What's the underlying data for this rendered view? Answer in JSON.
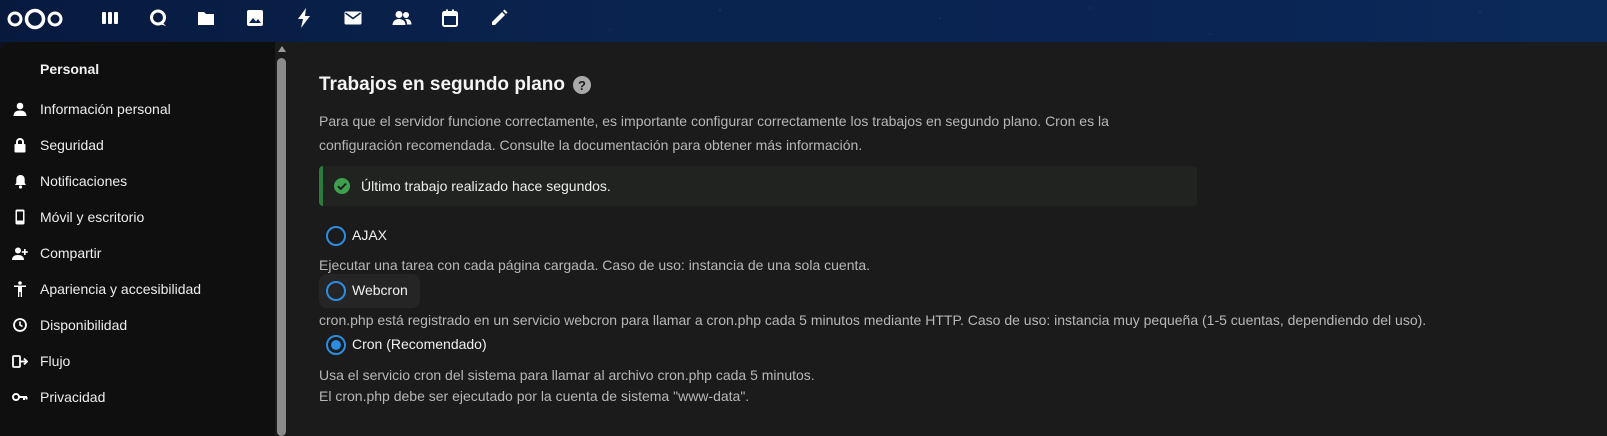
{
  "header": {
    "apps": [
      {
        "name": "dashboard-icon"
      },
      {
        "name": "talk-icon"
      },
      {
        "name": "files-icon"
      },
      {
        "name": "photos-icon"
      },
      {
        "name": "activity-icon"
      },
      {
        "name": "mail-icon"
      },
      {
        "name": "contacts-icon"
      },
      {
        "name": "calendar-icon"
      },
      {
        "name": "notes-edit-icon"
      }
    ]
  },
  "sidebar": {
    "caption": "Personal",
    "items": [
      {
        "label": "Información personal",
        "icon": "person-icon"
      },
      {
        "label": "Seguridad",
        "icon": "lock-icon"
      },
      {
        "label": "Notificaciones",
        "icon": "bell-icon"
      },
      {
        "label": "Móvil y escritorio",
        "icon": "phone-icon"
      },
      {
        "label": "Compartir",
        "icon": "share-person-icon"
      },
      {
        "label": "Apariencia y accesibilidad",
        "icon": "accessibility-icon"
      },
      {
        "label": "Disponibilidad",
        "icon": "clock-icon"
      },
      {
        "label": "Flujo",
        "icon": "flow-icon"
      },
      {
        "label": "Privacidad",
        "icon": "key-icon"
      }
    ]
  },
  "main": {
    "title": "Trabajos en segundo plano",
    "help_symbol": "?",
    "description_line1": "Para que el servidor funcione correctamente, es importante configurar correctamente los trabajos en segundo plano. Cron es la",
    "description_line2": "configuración recomendada. Consulte la documentación para obtener más información.",
    "notice": "Último trabajo realizado hace segundos.",
    "options": [
      {
        "label": "AJAX",
        "hint": "Ejecutar una tarea con cada página cargada. Caso de uso: instancia de una sola cuenta.",
        "selected": false
      },
      {
        "label": "Webcron",
        "hint": "cron.php está registrado en un servicio webcron para llamar a cron.php cada 5 minutos mediante HTTP. Caso de uso: instancia muy pequeña (1-5 cuentas, dependiendo del uso).",
        "selected": false
      },
      {
        "label": "Cron (Recomendado)",
        "hint": "Usa el servicio cron del sistema para llamar al archivo cron.php cada 5 minutos.",
        "hint2": "El cron.php debe ser ejecutado por la cuenta de sistema \"www-data\".",
        "selected": true
      }
    ]
  },
  "colors": {
    "accent": "#2c8ce0",
    "success": "#2d7b3c",
    "header_bg": "#0a2450",
    "panel_bg": "#1b1b1b",
    "sidebar_bg": "#0f0f0f"
  }
}
